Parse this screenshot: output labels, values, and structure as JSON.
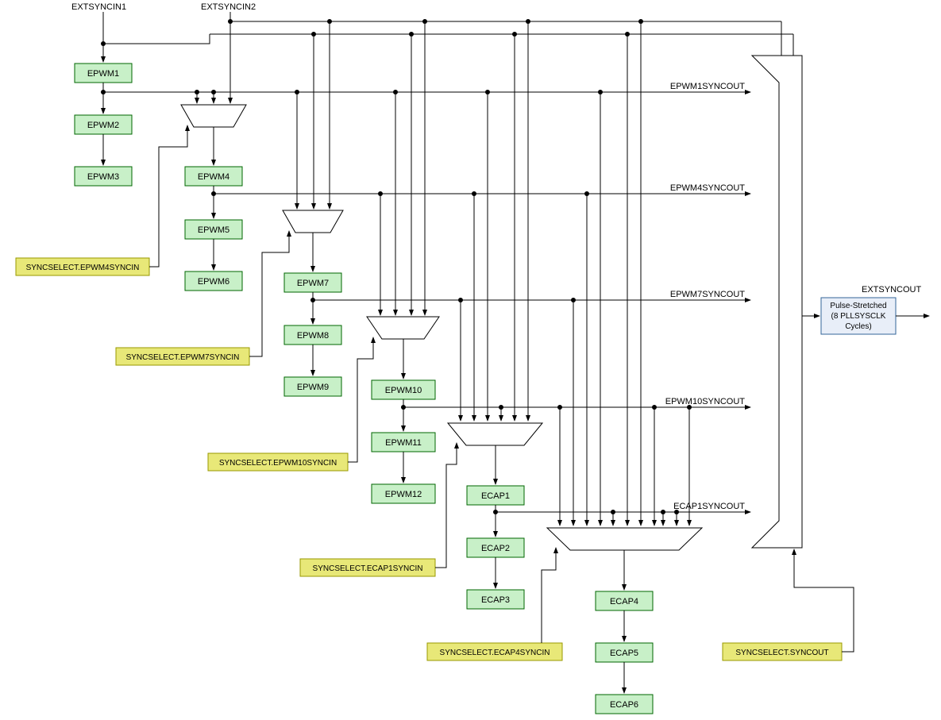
{
  "inputs": {
    "extsyncin1": "EXTSYNCIN1",
    "extsyncin2": "EXTSYNCIN2"
  },
  "outputs": {
    "extsyncout": "EXTSYNCOUT"
  },
  "epwm_blocks": {
    "epwm1": "EPWM1",
    "epwm2": "EPWM2",
    "epwm3": "EPWM3",
    "epwm4": "EPWM4",
    "epwm5": "EPWM5",
    "epwm6": "EPWM6",
    "epwm7": "EPWM7",
    "epwm8": "EPWM8",
    "epwm9": "EPWM9",
    "epwm10": "EPWM10",
    "epwm11": "EPWM11",
    "epwm12": "EPWM12"
  },
  "ecap_blocks": {
    "ecap1": "ECAP1",
    "ecap2": "ECAP2",
    "ecap3": "ECAP3",
    "ecap4": "ECAP4",
    "ecap5": "ECAP5",
    "ecap6": "ECAP6"
  },
  "syncselect_blocks": {
    "epwm4": "SYNCSELECT.EPWM4SYNCIN",
    "epwm7": "SYNCSELECT.EPWM7SYNCIN",
    "epwm10": "SYNCSELECT.EPWM10SYNCIN",
    "ecap1": "SYNCSELECT.ECAP1SYNCIN",
    "ecap4": "SYNCSELECT.ECAP4SYNCIN",
    "syncout": "SYNCSELECT.SYNCOUT"
  },
  "syncout_labels": {
    "epwm1": "EPWM1SYNCOUT",
    "epwm4": "EPWM4SYNCOUT",
    "epwm7": "EPWM7SYNCOUT",
    "epwm10": "EPWM10SYNCOUT",
    "ecap1": "ECAP1SYNCOUT"
  },
  "pulse_block": {
    "line1": "Pulse-Stretched",
    "line2": "(8 PLLSYSCLK",
    "line3": "Cycles)"
  }
}
